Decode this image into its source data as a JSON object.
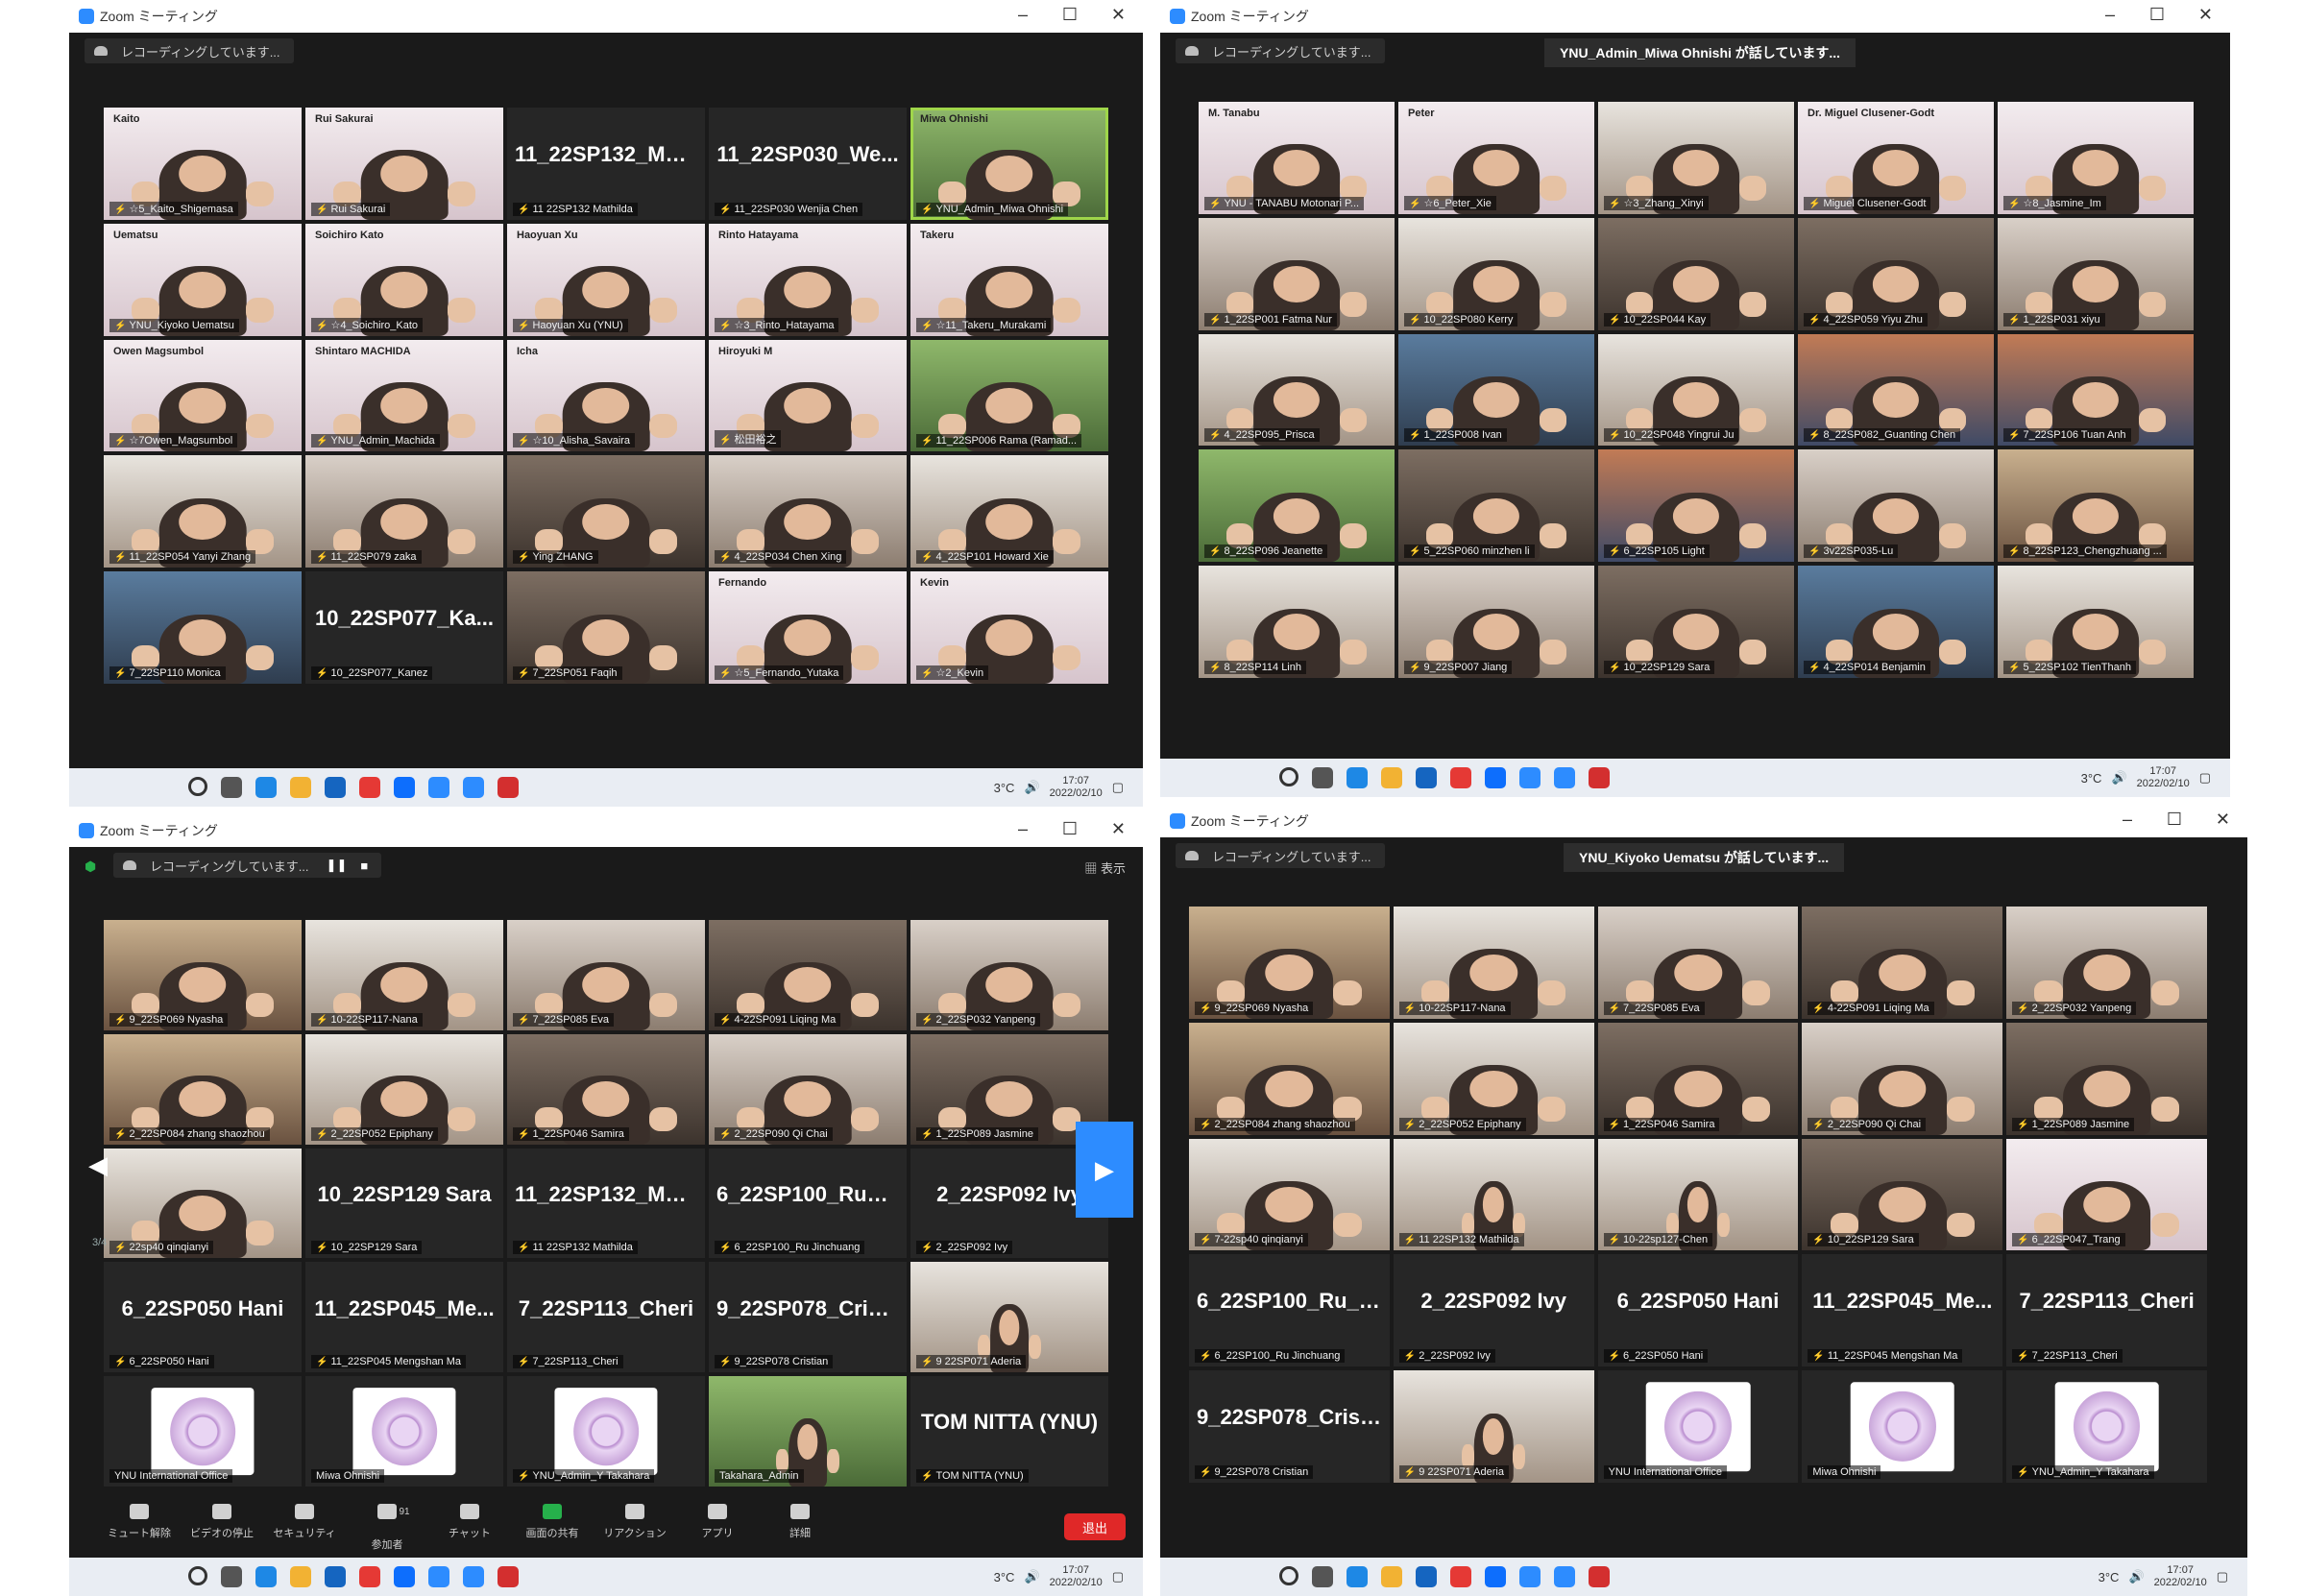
{
  "windows": [
    {
      "title": "Zoom ミーティング",
      "recording": "レコーディングしています...",
      "speaking": "",
      "taskbar_time": "17:07",
      "taskbar_date": "2022/02/10",
      "temp": "3°C",
      "tiles": [
        {
          "overlay": "Kaito",
          "caption": "☆5_Kaito_Shigemasa",
          "style": "v4"
        },
        {
          "overlay": "Rui Sakurai",
          "caption": "Rui Sakurai",
          "style": "v4"
        },
        {
          "big": "11_22SP132_Mat...",
          "caption": "11 22SP132 Mathilda"
        },
        {
          "big": "11_22SP030_We...",
          "caption": "11_22SP030 Wenjia Chen"
        },
        {
          "overlay": "Miwa Ohnishi",
          "caption": "YNU_Admin_Miwa Ohnishi",
          "style": "v6",
          "active": true
        },
        {
          "overlay": "Uematsu",
          "caption": "YNU_Kiyoko Uematsu",
          "style": "v4"
        },
        {
          "overlay": "Soichiro Kato",
          "caption": "☆4_Soichiro_Kato",
          "style": "v4"
        },
        {
          "overlay": "Haoyuan Xu",
          "caption": "Haoyuan Xu (YNU)",
          "style": "v4"
        },
        {
          "overlay": "Rinto Hatayama",
          "caption": "☆3_Rinto_Hatayama",
          "style": "v4"
        },
        {
          "overlay": "Takeru",
          "caption": "☆11_Takeru_Murakami",
          "style": "v4"
        },
        {
          "overlay": "Owen Magsumbol",
          "caption": "☆7Owen_Magsumbol",
          "style": "v4"
        },
        {
          "overlay": "Shintaro MACHIDA",
          "caption": "YNU_Admin_Machida",
          "style": "v4"
        },
        {
          "overlay": "Icha",
          "caption": "☆10_Alisha_Savaira",
          "style": "v4"
        },
        {
          "overlay": "Hiroyuki M",
          "caption": "松田裕之",
          "style": "v4"
        },
        {
          "caption": "11_22SP006 Rama (Ramad...",
          "style": "v6"
        },
        {
          "caption": "11_22SP054 Yanyi Zhang",
          "style": "v2"
        },
        {
          "caption": "11_22SP079 zaka",
          "style": "v1"
        },
        {
          "caption": "Ying ZHANG",
          "style": "v3"
        },
        {
          "caption": "4_22SP034 Chen Xing",
          "style": "v1"
        },
        {
          "caption": "4_22SP101 Howard Xie",
          "style": "v2"
        },
        {
          "caption": "7_22SP110 Monica",
          "style": "v8"
        },
        {
          "big": "10_22SP077_Ka...",
          "caption": "10_22SP077_Kanez"
        },
        {
          "caption": "7_22SP051 Faqih",
          "style": "v3"
        },
        {
          "overlay": "Fernando",
          "caption": "☆5_Fernando_Yutaka",
          "style": "v4"
        },
        {
          "overlay": "Kevin",
          "caption": "☆2_Kevin",
          "style": "v4"
        }
      ]
    },
    {
      "title": "Zoom ミーティング",
      "recording": "レコーディングしています...",
      "speaking": "YNU_Admin_Miwa Ohnishi が話しています...",
      "taskbar_time": "17:07",
      "taskbar_date": "2022/02/10",
      "temp": "3°C",
      "tiles": [
        {
          "overlay": "M. Tanabu",
          "caption": "YNU - TANABU Motonari P...",
          "style": "v4"
        },
        {
          "overlay": "Peter",
          "caption": "☆6_Peter_Xie",
          "style": "v4"
        },
        {
          "caption": "☆3_Zhang_Xinyi",
          "style": "v2"
        },
        {
          "overlay": "Dr. Miguel Clusener-Godt",
          "caption": "Miguel Clusener-Godt",
          "style": "v4"
        },
        {
          "caption": "☆8_Jasmine_Im",
          "style": "v4"
        },
        {
          "caption": "1_22SP001 Fatma Nur",
          "style": "v1"
        },
        {
          "caption": "10_22SP080 Kerry",
          "style": "v2"
        },
        {
          "caption": "10_22SP044 Kay",
          "style": "v3"
        },
        {
          "caption": "4_22SP059 Yiyu Zhu",
          "style": "v3"
        },
        {
          "caption": "1_22SP031 xiyu",
          "style": "v1"
        },
        {
          "caption": "4_22SP095_Prisca",
          "style": "v2"
        },
        {
          "caption": "1_22SP008 Ivan",
          "style": "v8"
        },
        {
          "caption": "10_22SP048 Yingrui Ju",
          "style": "v2"
        },
        {
          "caption": "8_22SP082_Guanting Chen",
          "style": "v5"
        },
        {
          "caption": "7_22SP106 Tuan Anh",
          "style": "v5"
        },
        {
          "caption": "8_22SP096 Jeanette",
          "style": "v6"
        },
        {
          "caption": "5_22SP060 minzhen li",
          "style": "v3"
        },
        {
          "caption": "6_22SP105 Light",
          "style": "v5"
        },
        {
          "caption": "3v22SP035-Lu",
          "style": "v1"
        },
        {
          "caption": "8_22SP123_Chengzhuang ...",
          "style": "v7"
        },
        {
          "caption": "8_22SP114 Linh",
          "style": "v2"
        },
        {
          "caption": "9_22SP007 Jiang",
          "style": "v1"
        },
        {
          "caption": "10_22SP129 Sara",
          "style": "v3"
        },
        {
          "caption": "4_22SP014 Benjamin",
          "style": "v8"
        },
        {
          "caption": "5_22SP102 TienThanh",
          "style": "v2"
        }
      ]
    },
    {
      "title": "Zoom ミーティング",
      "recording": "レコーディングしています...",
      "speaking": "",
      "view_label": "表示",
      "page": "3/4",
      "taskbar_time": "17:07",
      "taskbar_date": "2022/02/10",
      "temp": "3°C",
      "tiles": [
        {
          "caption": "9_22SP069 Nyasha",
          "style": "v7"
        },
        {
          "caption": "10-22SP117-Nana",
          "style": "v2"
        },
        {
          "caption": "7_22SP085 Eva",
          "style": "v1"
        },
        {
          "caption": "4-22SP091 Liqing Ma",
          "style": "v3"
        },
        {
          "caption": "2_22SP032 Yanpeng",
          "style": "v1"
        },
        {
          "caption": "2_22SP084 zhang shaozhou",
          "style": "v7"
        },
        {
          "caption": "2_22SP052 Epiphany",
          "style": "v2"
        },
        {
          "caption": "1_22SP046 Samira",
          "style": "v3"
        },
        {
          "caption": "2_22SP090 Qi Chai",
          "style": "v1"
        },
        {
          "caption": "1_22SP089 Jasmine",
          "style": "v3"
        },
        {
          "caption": "22sp40 qinqianyi",
          "style": "v2"
        },
        {
          "big": "10_22SP129 Sara",
          "caption": "10_22SP129 Sara"
        },
        {
          "big": "11_22SP132_Mat...",
          "caption": "11 22SP132 Mathilda"
        },
        {
          "big": "6_22SP100_Ru_Ji...",
          "caption": "6_22SP100_Ru Jinchuang"
        },
        {
          "big": "2_22SP092 Ivy",
          "caption": "2_22SP092 Ivy"
        },
        {
          "big": "6_22SP050 Hani",
          "caption": "6_22SP050 Hani"
        },
        {
          "big": "11_22SP045_Me...",
          "caption": "11_22SP045 Mengshan Ma"
        },
        {
          "big": "7_22SP113_Cheri",
          "caption": "7_22SP113_Cheri"
        },
        {
          "big": "9_22SP078_Crist...",
          "caption": "9_22SP078 Cristian"
        },
        {
          "caption": "9 22SP071 Aderia",
          "style": "v2",
          "small": true
        },
        {
          "logo": true,
          "caption": "YNU International Office",
          "nomute": true
        },
        {
          "logo": true,
          "caption": "Miwa Ohnishi",
          "nomute": true
        },
        {
          "logo": true,
          "caption": "YNU_Admin_Y Takahara"
        },
        {
          "caption": "Takahara_Admin",
          "style": "v6",
          "small": true,
          "nomute": true
        },
        {
          "big": "TOM NITTA (YNU)",
          "caption": "TOM NITTA (YNU)"
        }
      ],
      "toolbar": [
        {
          "label": "ミュート解除"
        },
        {
          "label": "ビデオの停止"
        },
        {
          "label": "セキュリティ"
        },
        {
          "label": "参加者",
          "count": "91"
        },
        {
          "label": "チャット"
        },
        {
          "label": "画面の共有",
          "green": true
        },
        {
          "label": "リアクション"
        },
        {
          "label": "アプリ"
        },
        {
          "label": "詳細"
        }
      ],
      "end_label": "退出"
    },
    {
      "title": "Zoom ミーティング",
      "recording": "レコーディングしています...",
      "speaking": "YNU_Kiyoko Uematsu が話しています...",
      "taskbar_time": "17:07",
      "taskbar_date": "2022/02/10",
      "temp": "3°C",
      "tiles": [
        {
          "caption": "9_22SP069 Nyasha",
          "style": "v7"
        },
        {
          "caption": "10-22SP117-Nana",
          "style": "v2"
        },
        {
          "caption": "7_22SP085 Eva",
          "style": "v1"
        },
        {
          "caption": "4-22SP091 Liqing Ma",
          "style": "v3"
        },
        {
          "caption": "2_22SP032 Yanpeng",
          "style": "v1"
        },
        {
          "caption": "2_22SP084 zhang shaozhou",
          "style": "v7"
        },
        {
          "caption": "2_22SP052 Epiphany",
          "style": "v2"
        },
        {
          "caption": "1_22SP046 Samira",
          "style": "v3"
        },
        {
          "caption": "2_22SP090 Qi Chai",
          "style": "v1"
        },
        {
          "caption": "1_22SP089 Jasmine",
          "style": "v3"
        },
        {
          "caption": "7-22sp40 qinqianyi",
          "style": "v2"
        },
        {
          "caption": "11 22SP132 Mathilda",
          "style": "v2",
          "small": true
        },
        {
          "caption": "10-22sp127-Chen",
          "style": "v2",
          "small": true
        },
        {
          "caption": "10_22SP129 Sara",
          "style": "v3"
        },
        {
          "caption": "6_22SP047_Trang",
          "style": "v4"
        },
        {
          "big": "6_22SP100_Ru_Ji...",
          "caption": "6_22SP100_Ru Jinchuang"
        },
        {
          "big": "2_22SP092 Ivy",
          "caption": "2_22SP092 Ivy"
        },
        {
          "big": "6_22SP050 Hani",
          "caption": "6_22SP050 Hani"
        },
        {
          "big": "11_22SP045_Me...",
          "caption": "11_22SP045 Mengshan Ma"
        },
        {
          "big": "7_22SP113_Cheri",
          "caption": "7_22SP113_Cheri"
        },
        {
          "big": "9_22SP078_Crist...",
          "caption": "9_22SP078 Cristian"
        },
        {
          "caption": "9 22SP071 Aderia",
          "style": "v2",
          "small": true
        },
        {
          "logo": true,
          "caption": "YNU International Office",
          "nomute": true
        },
        {
          "logo": true,
          "caption": "Miwa Ohnishi",
          "nomute": true
        },
        {
          "logo": true,
          "caption": "YNU_Admin_Y Takahara"
        }
      ]
    }
  ],
  "colors": {
    "zoom_blue": "#2d8cff",
    "active_speaker": "#9fd64a",
    "end_button": "#e02828",
    "share_green": "#26b04b",
    "taskbar": "#e9edf3"
  }
}
